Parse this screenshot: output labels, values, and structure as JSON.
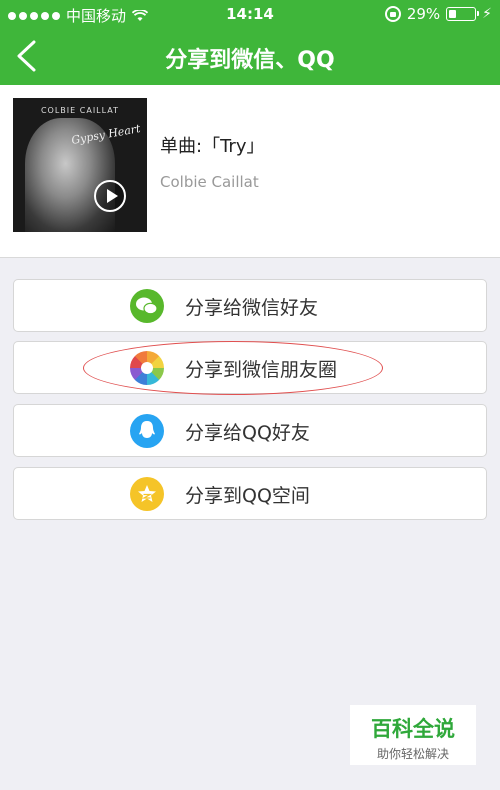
{
  "status": {
    "carrier": "中国移动",
    "time": "14:14",
    "battery_percent": "29%",
    "battery_level": 0.29
  },
  "nav": {
    "back_icon": "chevron-left-icon",
    "title": "分享到微信、QQ"
  },
  "song": {
    "title": "单曲:「Try」",
    "artist": "Colbie Caillat",
    "cover_artist_text": "COLBIE CAILLAT",
    "cover_script_text": "Gypsy Heart"
  },
  "share": {
    "options": [
      {
        "label": "分享给微信好友",
        "icon": "wechat-icon",
        "color": "#58b82c"
      },
      {
        "label": "分享到微信朋友圈",
        "icon": "moments-icon",
        "color": "#f4a938"
      },
      {
        "label": "分享给QQ好友",
        "icon": "qq-icon",
        "color": "#27a4f2"
      },
      {
        "label": "分享到QQ空间",
        "icon": "qzone-icon",
        "color": "#f5c428"
      }
    ]
  },
  "watermark": {
    "title": "百科全说",
    "subtitle": "助你轻松解决"
  },
  "colors": {
    "brand_green": "#3fb63a",
    "background": "#efeff4",
    "highlight_oval": "#e05050"
  }
}
